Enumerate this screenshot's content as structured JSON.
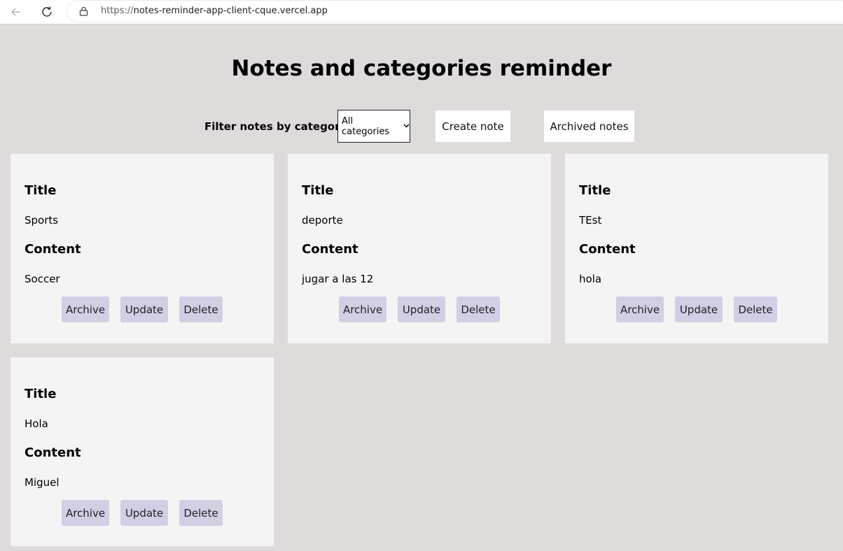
{
  "browser": {
    "url_host": "https://notes-reminder-app-client-cque.vercel.app",
    "url_scheme": "https://",
    "url_rest": "notes-reminder-app-client-cque.vercel.app"
  },
  "page": {
    "title": "Notes and categories reminder"
  },
  "toolbar": {
    "filter_label": "Filter notes by category",
    "filter_selected": "All categories",
    "create_label": "Create note",
    "archived_label": "Archived notes"
  },
  "labels": {
    "title_heading": "Title",
    "content_heading": "Content",
    "archive": "Archive",
    "update": "Update",
    "delete": "Delete"
  },
  "notes": [
    {
      "title": "Sports",
      "content": "Soccer"
    },
    {
      "title": "deporte",
      "content": "jugar a las 12"
    },
    {
      "title": "TEst",
      "content": "hola"
    },
    {
      "title": "Hola",
      "content": "Miguel"
    }
  ],
  "colors": {
    "background": "#e0dbdb",
    "card": "#f4f4f4",
    "action_button": "#d1cfe4"
  }
}
